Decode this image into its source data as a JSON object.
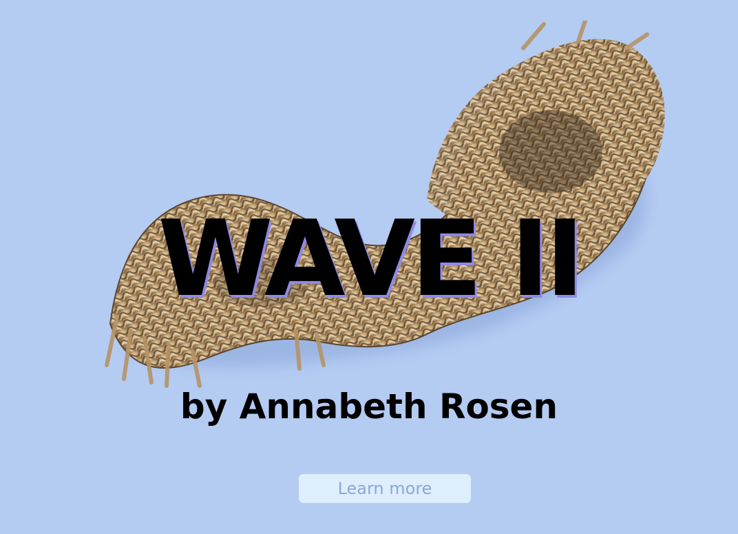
{
  "hero": {
    "title": "WAVE II",
    "byline": "by Annabeth Rosen",
    "cta_label": "Learn more",
    "image_alt": "ceramic-sculpture"
  },
  "colors": {
    "background": "#b4cbf2",
    "title_shadow": "#8e8ae6",
    "button_bg": "#dfeefd",
    "button_text": "#8aa8d8",
    "sculpture_light": "#e6d3b0",
    "sculpture_mid": "#b99668",
    "sculpture_dark": "#4a3a26"
  }
}
